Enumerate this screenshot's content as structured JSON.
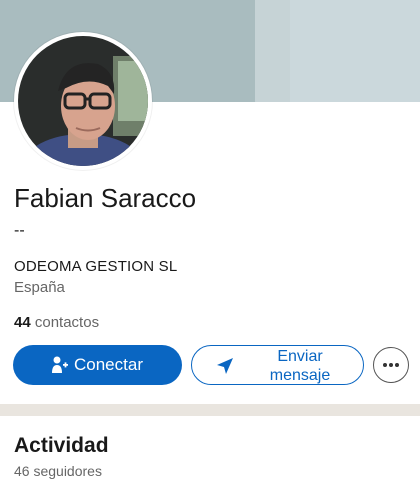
{
  "profile": {
    "name": "Fabian Saracco",
    "headline": "--",
    "company": "ODEOMA GESTION SL",
    "location": "España",
    "contacts_count": "44",
    "contacts_label": "contactos"
  },
  "actions": {
    "connect_label": "Conectar",
    "message_label": "Enviar mensaje",
    "more_icon": "ellipsis-icon"
  },
  "activity": {
    "title": "Actividad",
    "followers": "46 seguidores"
  },
  "colors": {
    "primary": "#0a66c2",
    "divider": "#e9e5df",
    "cover": "#a9bcbf"
  }
}
